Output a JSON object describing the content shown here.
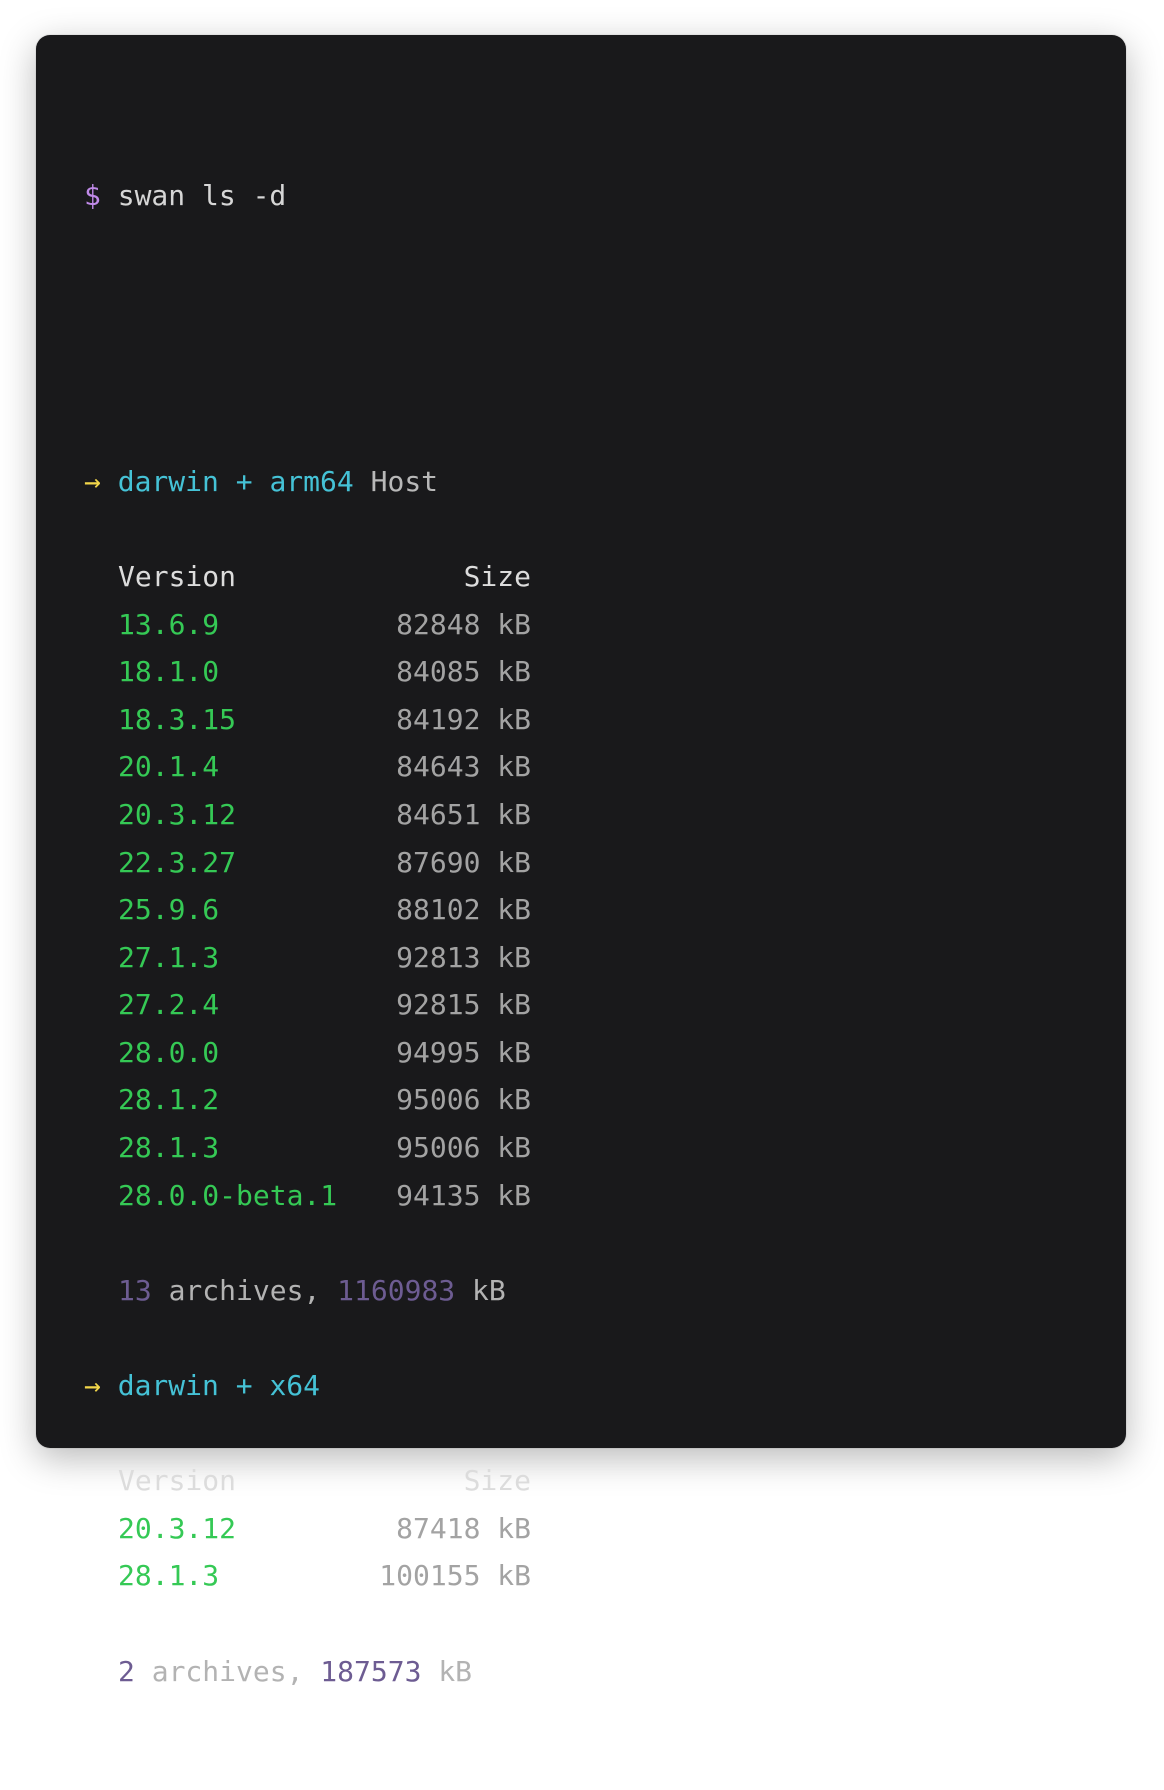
{
  "command": {
    "prompt": "$",
    "text": "swan ls -d"
  },
  "groups": [
    {
      "arrow": "→",
      "platform": "darwin",
      "plus": "+",
      "arch": "arm64",
      "tag": "Host",
      "headers": {
        "version": "Version",
        "size": "Size"
      },
      "rows": [
        {
          "version": "13.6.9",
          "size": "82848 kB"
        },
        {
          "version": "18.1.0",
          "size": "84085 kB"
        },
        {
          "version": "18.3.15",
          "size": "84192 kB"
        },
        {
          "version": "20.1.4",
          "size": "84643 kB"
        },
        {
          "version": "20.3.12",
          "size": "84651 kB"
        },
        {
          "version": "22.3.27",
          "size": "87690 kB"
        },
        {
          "version": "25.9.6",
          "size": "88102 kB"
        },
        {
          "version": "27.1.3",
          "size": "92813 kB"
        },
        {
          "version": "27.2.4",
          "size": "92815 kB"
        },
        {
          "version": "28.0.0",
          "size": "94995 kB"
        },
        {
          "version": "28.1.2",
          "size": "95006 kB"
        },
        {
          "version": "28.1.3",
          "size": "95006 kB"
        },
        {
          "version": "28.0.0-beta.1",
          "size": "94135 kB"
        }
      ],
      "summary": {
        "count": "13",
        "label": "archives,",
        "total": "1160983",
        "unit": "kB"
      }
    },
    {
      "arrow": "→",
      "platform": "darwin",
      "plus": "+",
      "arch": "x64",
      "tag": "",
      "headers": {
        "version": "Version",
        "size": "Size"
      },
      "rows": [
        {
          "version": "20.3.12",
          "size": "87418 kB"
        },
        {
          "version": "28.1.3",
          "size": "100155 kB"
        }
      ],
      "summary": {
        "count": "2",
        "label": "archives,",
        "total": "187573",
        "unit": "kB"
      }
    }
  ],
  "colors": {
    "background": "#19191b",
    "prompt": "#c08ae8",
    "arrow": "#f2d64a",
    "host": "#45c2d6",
    "version": "#35c955",
    "size": "#a3a3a3",
    "count": "#6d5c92"
  }
}
